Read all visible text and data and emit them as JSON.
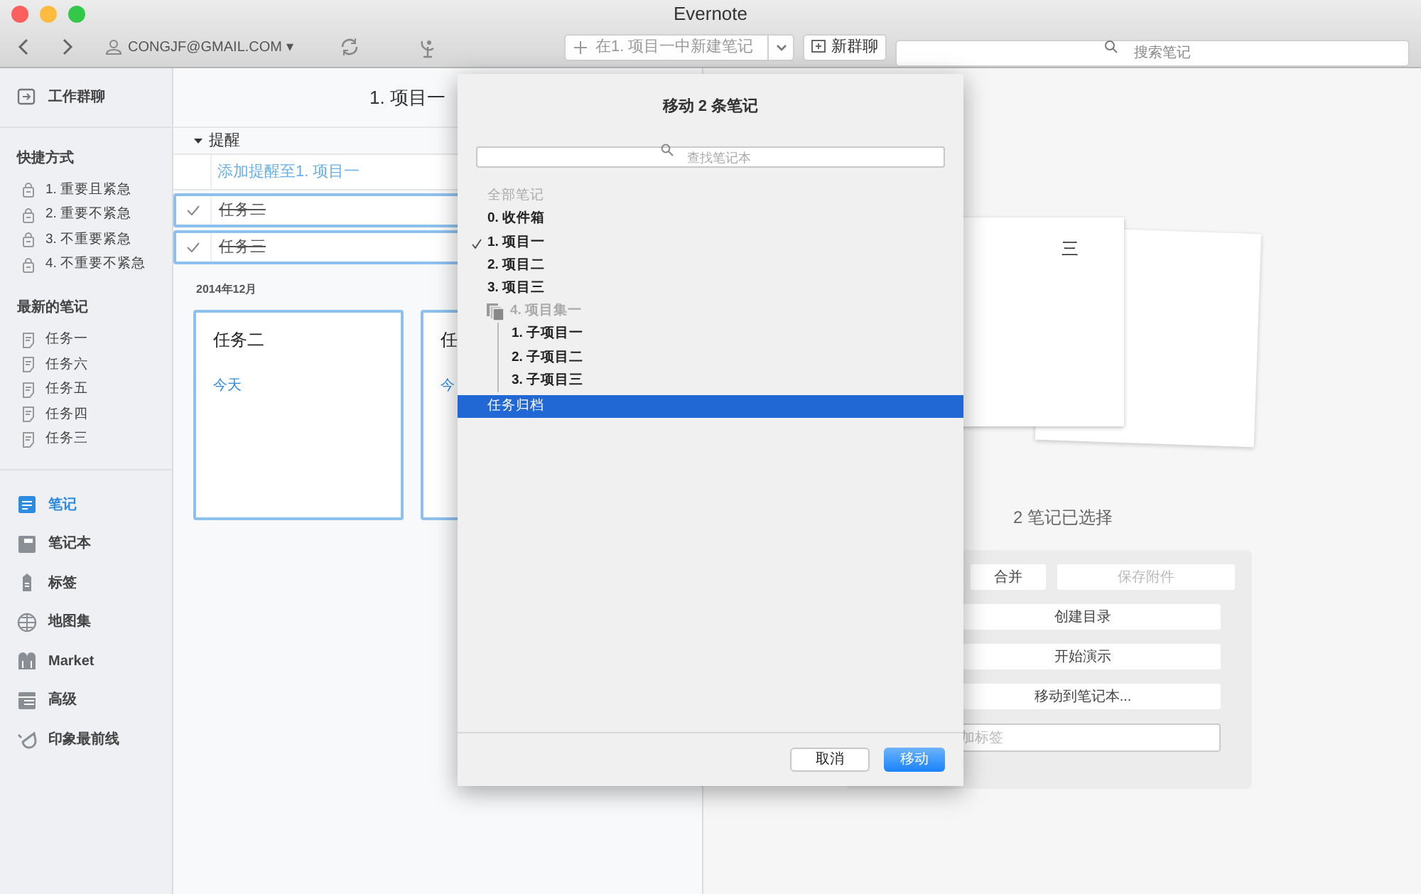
{
  "window": {
    "title": "Evernote"
  },
  "toolbar": {
    "account": "CONGJF@GMAIL.COM",
    "account_caret": "▾",
    "new_note": "在1. 项目一中新建笔记",
    "new_chat": "新群聊",
    "search": {
      "placeholder": "搜索笔记"
    }
  },
  "sidebar": {
    "top_item": "工作群聊",
    "shortcuts": {
      "title": "快捷方式",
      "items": [
        "1. 重要且紧急",
        "2. 重要不紧急",
        "3. 不重要紧急",
        "4. 不重要不紧急"
      ]
    },
    "recent": {
      "title": "最新的笔记",
      "items": [
        "任务一",
        "任务六",
        "任务五",
        "任务四",
        "任务三"
      ]
    },
    "nav": [
      {
        "label": "笔记",
        "kind": "notes",
        "selected": true
      },
      {
        "label": "笔记本",
        "kind": "notebooks",
        "selected": false
      },
      {
        "label": "标签",
        "kind": "tags",
        "selected": false
      },
      {
        "label": "地图集",
        "kind": "atlas",
        "selected": false
      },
      {
        "label": "Market",
        "kind": "market",
        "selected": false
      },
      {
        "label": "高级",
        "kind": "premium",
        "selected": false
      },
      {
        "label": "印象最前线",
        "kind": "horn",
        "selected": false
      }
    ]
  },
  "note_list": {
    "title": "1. 项目一",
    "reminders": {
      "title": "提醒",
      "expanded": true,
      "add_link": "添加提醒至1. 项目一",
      "tasks": [
        {
          "title": "任务二",
          "checked": true
        },
        {
          "title": "任务三",
          "checked": true
        }
      ]
    },
    "date_group": "2014年12月",
    "cards": [
      {
        "title": "任务二",
        "date": "今天"
      },
      {
        "title": "任",
        "date": "今"
      }
    ]
  },
  "detail": {
    "preview_title": "三",
    "selection_count": "2 笔记已选择",
    "actions": [
      {
        "label": "合并",
        "disabled": false
      },
      {
        "label": "保存附件",
        "disabled": true
      }
    ],
    "wide_actions": [
      "创建目录",
      "开始演示",
      "移动到笔记本..."
    ],
    "tag_field": {
      "placeholder": "加标签"
    }
  },
  "dialog": {
    "title": "移动 2 条笔记",
    "search": {
      "placeholder": "查找笔记本"
    },
    "group_label": "全部笔记",
    "notebooks": [
      {
        "label": "0. 收件箱",
        "kind": "notebook",
        "checked": false,
        "selected": false
      },
      {
        "label": "1. 项目一",
        "kind": "notebook",
        "checked": true,
        "selected": false
      },
      {
        "label": "2. 项目二",
        "kind": "notebook",
        "checked": false,
        "selected": false
      },
      {
        "label": "3. 项目三",
        "kind": "notebook",
        "checked": false,
        "selected": false
      },
      {
        "label": "4. 项目集一",
        "kind": "stack",
        "checked": false,
        "selected": false,
        "children": [
          {
            "label": "1. 子项目一",
            "kind": "notebook",
            "checked": false,
            "selected": false
          },
          {
            "label": "2. 子项目二",
            "kind": "notebook",
            "checked": false,
            "selected": false
          },
          {
            "label": "3. 子项目三",
            "kind": "notebook",
            "checked": false,
            "selected": false
          }
        ]
      },
      {
        "label": "任务归档",
        "kind": "notebook",
        "checked": false,
        "selected": true
      }
    ],
    "buttons": [
      {
        "label": "取消",
        "primary": false
      },
      {
        "label": "移动",
        "primary": true
      }
    ]
  }
}
